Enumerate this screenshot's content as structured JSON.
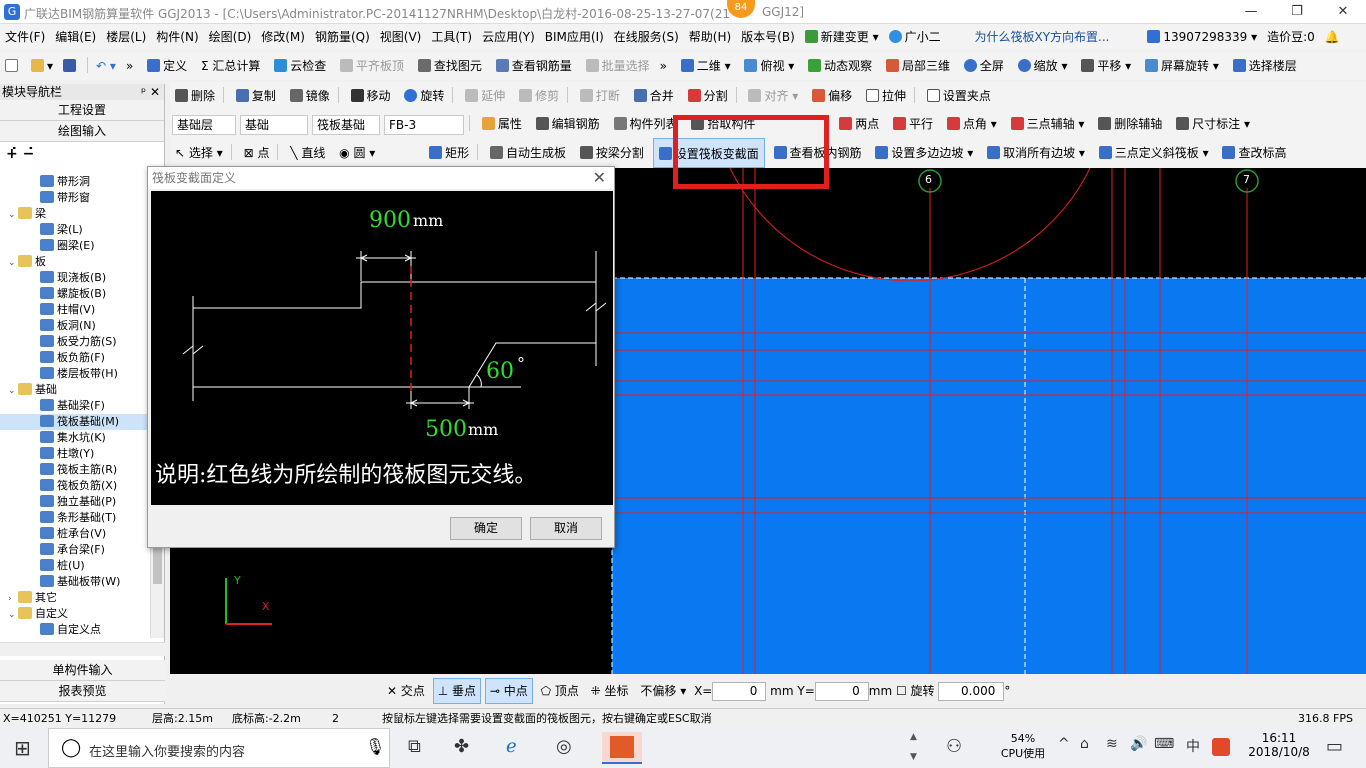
{
  "window": {
    "title": "广联达BIM钢筋算量软件 GGJ2013 - [C:\\Users\\Administrator.PC-20141127NRHM\\Desktop\\白龙村-2016-08-25-13-27-07(21",
    "title_end": "GGJ12]",
    "badge": "84"
  },
  "menubar": {
    "items": [
      "文件(F)",
      "编辑(E)",
      "楼层(L)",
      "构件(N)",
      "绘图(D)",
      "修改(M)",
      "钢筋量(Q)",
      "视图(V)",
      "工具(T)",
      "云应用(Y)",
      "BIM应用(I)",
      "在线服务(S)",
      "帮助(H)",
      "版本号(B)",
      "新建变更",
      "广小二"
    ],
    "question": "为什么筏板XY方向布置...",
    "phone": "13907298339",
    "coin": "造价豆:0"
  },
  "toolbar1": {
    "items": [
      "定义",
      "Σ 汇总计算",
      "云检查",
      "平齐板顶",
      "查找图元",
      "查看钢筋量",
      "批量选择",
      "二维",
      "俯视",
      "动态观察",
      "局部三维",
      "全屏",
      "缩放",
      "平移",
      "屏幕旋转",
      "选择楼层"
    ]
  },
  "toolbar2": {
    "items": [
      "删除",
      "复制",
      "镜像",
      "移动",
      "旋转",
      "延伸",
      "修剪",
      "打断",
      "合并",
      "分割",
      "对齐",
      "偏移",
      "拉伸",
      "设置夹点"
    ]
  },
  "toolbar3": {
    "floor": "基础层",
    "category": "基础",
    "type": "筏板基础",
    "element": "FB-3",
    "items": [
      "属性",
      "编辑钢筋",
      "构件列表",
      "拾取构件",
      "两点",
      "平行",
      "点角",
      "三点辅轴",
      "删除辅轴",
      "尺寸标注"
    ]
  },
  "toolbar4": {
    "items": [
      "选择",
      "点",
      "直线",
      "圆",
      "矩形",
      "自动生成板",
      "按梁分割",
      "设置筏板变截面",
      "查看板内钢筋",
      "设置多边边坡",
      "取消所有边坡",
      "三点定义斜筏板",
      "查改标高"
    ]
  },
  "nav": {
    "title": "模块导航栏",
    "btn_settings": "工程设置",
    "btn_draw": "绘图输入",
    "btn_single": "单构件输入",
    "btn_report": "报表预览",
    "tree": [
      {
        "lvl": 2,
        "label": "带形洞"
      },
      {
        "lvl": 2,
        "label": "带形窗"
      },
      {
        "lvl": 1,
        "label": "梁",
        "open": true
      },
      {
        "lvl": 2,
        "label": "梁(L)"
      },
      {
        "lvl": 2,
        "label": "圈梁(E)"
      },
      {
        "lvl": 1,
        "label": "板",
        "open": true
      },
      {
        "lvl": 2,
        "label": "现浇板(B)"
      },
      {
        "lvl": 2,
        "label": "螺旋板(B)"
      },
      {
        "lvl": 2,
        "label": "柱帽(V)"
      },
      {
        "lvl": 2,
        "label": "板洞(N)"
      },
      {
        "lvl": 2,
        "label": "板受力筋(S)"
      },
      {
        "lvl": 2,
        "label": "板负筋(F)"
      },
      {
        "lvl": 2,
        "label": "楼层板带(H)"
      },
      {
        "lvl": 1,
        "label": "基础",
        "open": true
      },
      {
        "lvl": 2,
        "label": "基础梁(F)"
      },
      {
        "lvl": 2,
        "label": "筏板基础(M)",
        "selected": true
      },
      {
        "lvl": 2,
        "label": "集水坑(K)"
      },
      {
        "lvl": 2,
        "label": "柱墩(Y)"
      },
      {
        "lvl": 2,
        "label": "筏板主筋(R)"
      },
      {
        "lvl": 2,
        "label": "筏板负筋(X)"
      },
      {
        "lvl": 2,
        "label": "独立基础(P)"
      },
      {
        "lvl": 2,
        "label": "条形基础(T)"
      },
      {
        "lvl": 2,
        "label": "桩承台(V)"
      },
      {
        "lvl": 2,
        "label": "承台梁(F)"
      },
      {
        "lvl": 2,
        "label": "桩(U)"
      },
      {
        "lvl": 2,
        "label": "基础板带(W)"
      },
      {
        "lvl": 1,
        "label": "其它",
        "open": false
      },
      {
        "lvl": 1,
        "label": "自定义",
        "open": true
      },
      {
        "lvl": 2,
        "label": "自定义点"
      }
    ]
  },
  "dialog": {
    "title": "筏板变截面定义",
    "dim_top": "900",
    "dim_bottom": "500",
    "unit": "mm",
    "angle": "60",
    "degree": "°",
    "note": "说明:红色线为所绘制的筏板图元交线。",
    "ok": "确定",
    "cancel": "取消"
  },
  "canvas": {
    "axis_6": "6",
    "axis_7": "7",
    "axis_x": "X",
    "axis_y": "Y",
    "fill_color": "#0a78f0"
  },
  "snapbar": {
    "items": [
      "交点",
      "垂点",
      "中点",
      "顶点",
      "坐标"
    ],
    "offset": "不偏移",
    "x_label": "X=",
    "x_val": "0",
    "y_label": "mm Y=",
    "y_val": "0",
    "mm": "mm",
    "rotate": "旋转",
    "rot_val": "0.000",
    "deg": "°"
  },
  "statusbar": {
    "coords": "X=410251 Y=11279",
    "floor_h": "层高:2.15m",
    "base_h": "底标高:-2.2m",
    "num": "2",
    "hint": "按鼠标左键选择需要设置变截面的筏板图元，按右键确定或ESC取消",
    "fps": "316.8 FPS"
  },
  "taskbar": {
    "search": "在这里输入你要搜索的内容",
    "cpu": "54%",
    "cpu_label": "CPU使用",
    "lang": "中",
    "time": "16:11",
    "date": "2018/10/8"
  }
}
